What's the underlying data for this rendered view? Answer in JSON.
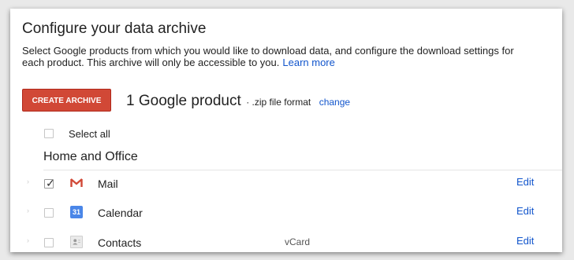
{
  "header": {
    "title": "Configure your data archive",
    "description": "Select Google products from which you would like to download data, and configure the download settings for each product. This archive will only be accessible to you.",
    "learn_more": "Learn more"
  },
  "actions": {
    "create_label": "CREATE ARCHIVE",
    "product_count": "1 Google product",
    "format_text": "· .zip file format",
    "change_label": "change"
  },
  "select_all": {
    "label": "Select all",
    "checked": false
  },
  "section": {
    "title": "Home and Office"
  },
  "products": [
    {
      "name": "Mail",
      "icon": "gmail-icon",
      "checked": true,
      "format": "",
      "edit_label": "Edit"
    },
    {
      "name": "Calendar",
      "icon": "calendar-icon",
      "icon_text": "31",
      "checked": false,
      "format": "",
      "edit_label": "Edit"
    },
    {
      "name": "Contacts",
      "icon": "contacts-icon",
      "checked": false,
      "format": "vCard",
      "edit_label": "Edit"
    }
  ],
  "colors": {
    "accent_red": "#d14836",
    "link_blue": "#1155cc",
    "calendar_blue": "#4a86e8"
  }
}
